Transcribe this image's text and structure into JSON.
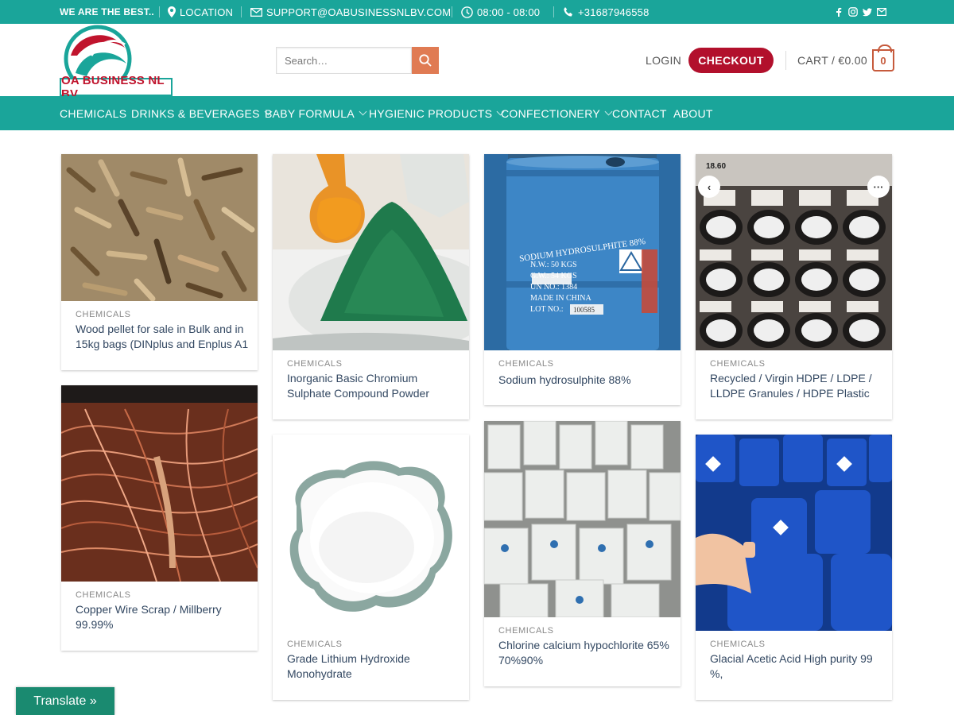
{
  "topbar": {
    "tagline": "WE ARE THE BEST..",
    "location": "LOCATION",
    "email": "SUPPORT@OABUSINESSNLBV.COM",
    "hours": "08:00 - 08:00",
    "phone": "+31687946558",
    "social_icons": [
      "facebook-icon",
      "instagram-icon",
      "twitter-icon",
      "email-icon"
    ]
  },
  "header": {
    "logo_text": "OA BUSINESS NL BV",
    "search_placeholder": "Search…",
    "login": "LOGIN",
    "checkout": "CHECKOUT",
    "cart": "CART / €0.00",
    "cart_count": "0"
  },
  "nav": {
    "items": [
      {
        "label": "CHEMICALS",
        "dropdown": false
      },
      {
        "label": "DRINKS & BEVERAGES",
        "dropdown": true
      },
      {
        "label": "BABY FORMULA",
        "dropdown": true
      },
      {
        "label": "HYGIENIC PRODUCTS",
        "dropdown": true
      },
      {
        "label": "CONFECTIONERY",
        "dropdown": true
      },
      {
        "label": "CONTACT",
        "dropdown": false
      },
      {
        "label": "ABOUT",
        "dropdown": false
      }
    ]
  },
  "products": [
    {
      "category": "CHEMICALS",
      "title": "Wood pellet for sale in Bulk and in 15kg bags (DINplus and Enplus A1"
    },
    {
      "category": "CHEMICALS",
      "title": "Inorganic Basic Chromium Sulphate Compound Powder"
    },
    {
      "category": "CHEMICALS",
      "title": "Sodium hydrosulphite 88%"
    },
    {
      "category": "CHEMICALS",
      "title": "Recycled / Virgin HDPE / LDPE / LLDPE Granules / HDPE Plastic"
    },
    {
      "category": "CHEMICALS",
      "title": "Copper Wire Scrap / Millberry 99.99%"
    },
    {
      "category": "CHEMICALS",
      "title": "Grade Lithium Hydroxide Monohydrate"
    },
    {
      "category": "CHEMICALS",
      "title": "Chlorine calcium hypochlorite 65% 70%90%"
    },
    {
      "category": "CHEMICALS",
      "title": "Glacial Acetic Acid High purity 99 %,"
    }
  ],
  "image_texts": {
    "drum_label": "SODIUM HYDROSULPHITE 88%",
    "drum_nw": "N.W.: 50 KGS",
    "drum_gw": "G.W.: 54 KGS",
    "drum_un": "UN NO.: 1384",
    "drum_made": "MADE IN CHINA",
    "drum_lot": "LOT NO.:",
    "drum_lot_value": "100585",
    "phone_time": "18.60"
  },
  "translate": "Translate »",
  "colors": {
    "teal": "#1aa59a",
    "checkout": "#b2102c",
    "search_button": "#e07b53",
    "translate": "#1a8a70"
  }
}
